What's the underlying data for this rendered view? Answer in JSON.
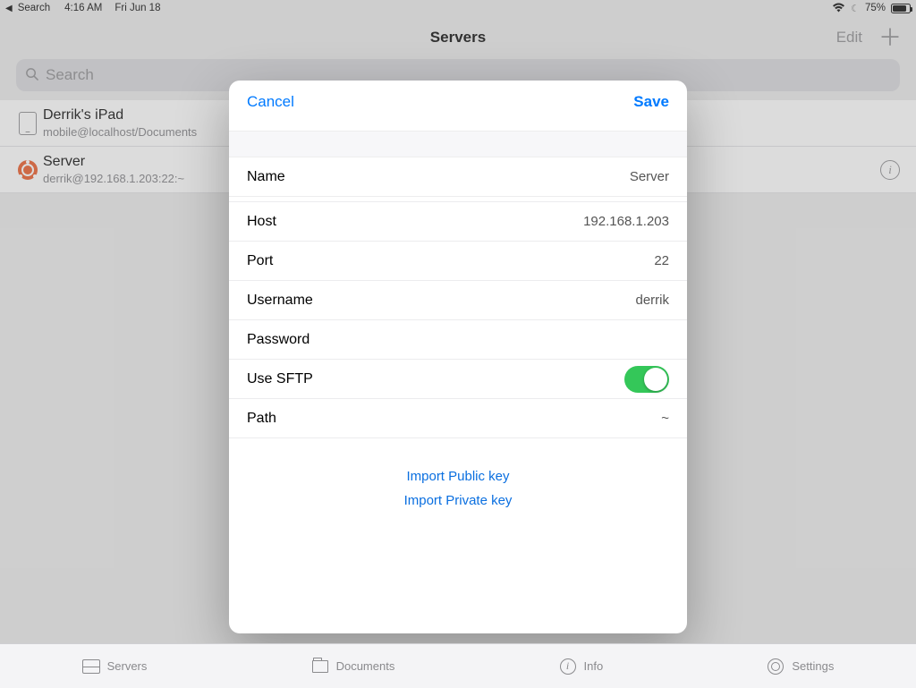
{
  "status_bar": {
    "back_app": "Search",
    "time": "4:16 AM",
    "date": "Fri Jun 18",
    "battery_pct": "75%"
  },
  "header": {
    "title": "Servers",
    "edit": "Edit"
  },
  "search": {
    "placeholder": "Search"
  },
  "server_list": [
    {
      "title": "Derrik's iPad",
      "subtitle": "mobile@localhost/Documents",
      "icon": "ipad-icon",
      "has_info": false
    },
    {
      "title": "Server",
      "subtitle": "derrik@192.168.1.203:22:~",
      "icon": "ubuntu-icon",
      "has_info": true
    }
  ],
  "modal": {
    "cancel": "Cancel",
    "save": "Save",
    "fields": {
      "name_label": "Name",
      "name_value": "Server",
      "host_label": "Host",
      "host_value": "192.168.1.203",
      "port_label": "Port",
      "port_value": "22",
      "user_label": "Username",
      "user_value": "derrik",
      "pass_label": "Password",
      "pass_value": "",
      "sftp_label": "Use SFTP",
      "sftp_on": true,
      "path_label": "Path",
      "path_value": "~"
    },
    "import_public": "Import Public key",
    "import_private": "Import Private key"
  },
  "tabs": {
    "servers": "Servers",
    "documents": "Documents",
    "info": "Info",
    "settings": "Settings"
  }
}
